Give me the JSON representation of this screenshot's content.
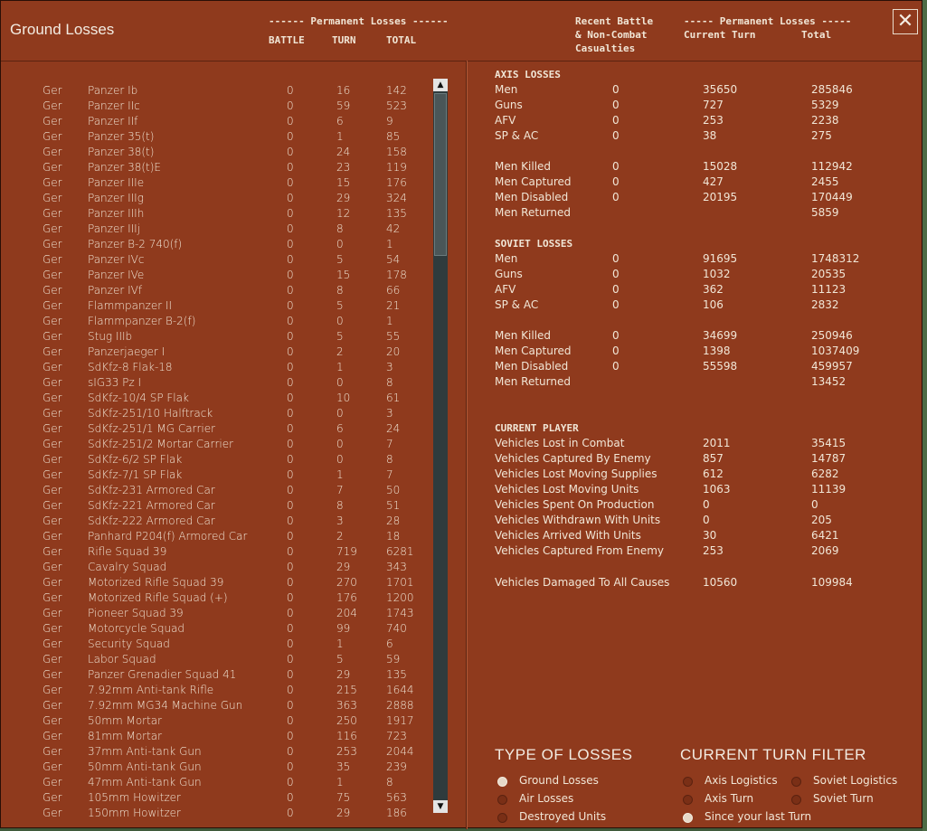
{
  "window": {
    "title": "Ground Losses",
    "close_icon": "close-icon"
  },
  "header": {
    "perm_losses_left": "------ Permanent Losses ------",
    "col_battle": "BATTLE",
    "col_turn": "TURN",
    "col_total": "TOTAL",
    "recent_battle": "Recent Battle",
    "non_combat": "& Non-Combat",
    "casualties": "Casualties",
    "perm_losses_right": "----- Permanent Losses -----",
    "col_current_turn": "Current Turn",
    "col_total_right": "Total"
  },
  "units": [
    {
      "nat": "Ger",
      "name": "Panzer Ib",
      "battle": "0",
      "turn": "16",
      "total": "142"
    },
    {
      "nat": "Ger",
      "name": "Panzer IIc",
      "battle": "0",
      "turn": "59",
      "total": "523"
    },
    {
      "nat": "Ger",
      "name": "Panzer IIf",
      "battle": "0",
      "turn": "6",
      "total": "9"
    },
    {
      "nat": "Ger",
      "name": "Panzer 35(t)",
      "battle": "0",
      "turn": "1",
      "total": "85"
    },
    {
      "nat": "Ger",
      "name": "Panzer 38(t)",
      "battle": "0",
      "turn": "24",
      "total": "158"
    },
    {
      "nat": "Ger",
      "name": "Panzer 38(t)E",
      "battle": "0",
      "turn": "23",
      "total": "119"
    },
    {
      "nat": "Ger",
      "name": "Panzer IIIe",
      "battle": "0",
      "turn": "15",
      "total": "176"
    },
    {
      "nat": "Ger",
      "name": "Panzer IIIg",
      "battle": "0",
      "turn": "29",
      "total": "324"
    },
    {
      "nat": "Ger",
      "name": "Panzer IIIh",
      "battle": "0",
      "turn": "12",
      "total": "135"
    },
    {
      "nat": "Ger",
      "name": "Panzer IIIj",
      "battle": "0",
      "turn": "8",
      "total": "42"
    },
    {
      "nat": "Ger",
      "name": "Panzer B-2 740(f)",
      "battle": "0",
      "turn": "0",
      "total": "1"
    },
    {
      "nat": "Ger",
      "name": "Panzer IVc",
      "battle": "0",
      "turn": "5",
      "total": "54"
    },
    {
      "nat": "Ger",
      "name": "Panzer IVe",
      "battle": "0",
      "turn": "15",
      "total": "178"
    },
    {
      "nat": "Ger",
      "name": "Panzer IVf",
      "battle": "0",
      "turn": "8",
      "total": "66"
    },
    {
      "nat": "Ger",
      "name": "Flammpanzer II",
      "battle": "0",
      "turn": "5",
      "total": "21"
    },
    {
      "nat": "Ger",
      "name": "Flammpanzer B-2(f)",
      "battle": "0",
      "turn": "0",
      "total": "1"
    },
    {
      "nat": "Ger",
      "name": "Stug IIIb",
      "battle": "0",
      "turn": "5",
      "total": "55"
    },
    {
      "nat": "Ger",
      "name": "Panzerjaeger I",
      "battle": "0",
      "turn": "2",
      "total": "20"
    },
    {
      "nat": "Ger",
      "name": "SdKfz-8 Flak-18",
      "battle": "0",
      "turn": "1",
      "total": "3"
    },
    {
      "nat": "Ger",
      "name": "sIG33 Pz I",
      "battle": "0",
      "turn": "0",
      "total": "8"
    },
    {
      "nat": "Ger",
      "name": "SdKfz-10/4 SP Flak",
      "battle": "0",
      "turn": "10",
      "total": "61"
    },
    {
      "nat": "Ger",
      "name": "SdKfz-251/10 Halftrack",
      "battle": "0",
      "turn": "0",
      "total": "3"
    },
    {
      "nat": "Ger",
      "name": "SdKfz-251/1 MG Carrier",
      "battle": "0",
      "turn": "6",
      "total": "24"
    },
    {
      "nat": "Ger",
      "name": "SdKfz-251/2 Mortar Carrier",
      "battle": "0",
      "turn": "0",
      "total": "7"
    },
    {
      "nat": "Ger",
      "name": "SdKfz-6/2 SP Flak",
      "battle": "0",
      "turn": "0",
      "total": "8"
    },
    {
      "nat": "Ger",
      "name": "SdKfz-7/1 SP Flak",
      "battle": "0",
      "turn": "1",
      "total": "7"
    },
    {
      "nat": "Ger",
      "name": "SdKfz-231 Armored Car",
      "battle": "0",
      "turn": "7",
      "total": "50"
    },
    {
      "nat": "Ger",
      "name": "SdKfz-221 Armored Car",
      "battle": "0",
      "turn": "8",
      "total": "51"
    },
    {
      "nat": "Ger",
      "name": "SdKfz-222 Armored Car",
      "battle": "0",
      "turn": "3",
      "total": "28"
    },
    {
      "nat": "Ger",
      "name": "Panhard P204(f) Armored Car",
      "battle": "0",
      "turn": "2",
      "total": "18"
    },
    {
      "nat": "Ger",
      "name": "Rifle Squad 39",
      "battle": "0",
      "turn": "719",
      "total": "6281"
    },
    {
      "nat": "Ger",
      "name": "Cavalry Squad",
      "battle": "0",
      "turn": "29",
      "total": "343"
    },
    {
      "nat": "Ger",
      "name": "Motorized Rifle Squad 39",
      "battle": "0",
      "turn": "270",
      "total": "1701"
    },
    {
      "nat": "Ger",
      "name": "Motorized Rifle Squad (+)",
      "battle": "0",
      "turn": "176",
      "total": "1200"
    },
    {
      "nat": "Ger",
      "name": "Pioneer Squad 39",
      "battle": "0",
      "turn": "204",
      "total": "1743"
    },
    {
      "nat": "Ger",
      "name": "Motorcycle Squad",
      "battle": "0",
      "turn": "99",
      "total": "740"
    },
    {
      "nat": "Ger",
      "name": "Security Squad",
      "battle": "0",
      "turn": "1",
      "total": "6"
    },
    {
      "nat": "Ger",
      "name": "Labor Squad",
      "battle": "0",
      "turn": "5",
      "total": "59"
    },
    {
      "nat": "Ger",
      "name": "Panzer Grenadier Squad 41",
      "battle": "0",
      "turn": "29",
      "total": "135"
    },
    {
      "nat": "Ger",
      "name": "7.92mm Anti-tank Rifle",
      "battle": "0",
      "turn": "215",
      "total": "1644"
    },
    {
      "nat": "Ger",
      "name": "7.92mm MG34 Machine Gun",
      "battle": "0",
      "turn": "363",
      "total": "2888"
    },
    {
      "nat": "Ger",
      "name": "50mm Mortar",
      "battle": "0",
      "turn": "250",
      "total": "1917"
    },
    {
      "nat": "Ger",
      "name": "81mm Mortar",
      "battle": "0",
      "turn": "116",
      "total": "723"
    },
    {
      "nat": "Ger",
      "name": "37mm Anti-tank Gun",
      "battle": "0",
      "turn": "253",
      "total": "2044"
    },
    {
      "nat": "Ger",
      "name": "50mm Anti-tank Gun",
      "battle": "0",
      "turn": "35",
      "total": "239"
    },
    {
      "nat": "Ger",
      "name": "47mm Anti-tank Gun",
      "battle": "0",
      "turn": "1",
      "total": "8"
    },
    {
      "nat": "Ger",
      "name": "105mm Howitzer",
      "battle": "0",
      "turn": "75",
      "total": "563"
    },
    {
      "nat": "Ger",
      "name": "150mm Howitzer",
      "battle": "0",
      "turn": "29",
      "total": "186"
    }
  ],
  "axis": {
    "heading": "AXIS LOSSES",
    "rows": [
      {
        "label": "Men",
        "recent": "0",
        "turn": "35650",
        "total": "285846"
      },
      {
        "label": "Guns",
        "recent": "0",
        "turn": "727",
        "total": "5329"
      },
      {
        "label": "AFV",
        "recent": "0",
        "turn": "253",
        "total": "2238"
      },
      {
        "label": "SP & AC",
        "recent": "0",
        "turn": "38",
        "total": "275"
      }
    ],
    "rows2": [
      {
        "label": "Men Killed",
        "recent": "0",
        "turn": "15028",
        "total": "112942"
      },
      {
        "label": "Men Captured",
        "recent": "0",
        "turn": "427",
        "total": "2455"
      },
      {
        "label": "Men Disabled",
        "recent": "0",
        "turn": "20195",
        "total": "170449"
      },
      {
        "label": "Men Returned",
        "recent": "",
        "turn": "",
        "total": "5859"
      }
    ]
  },
  "soviet": {
    "heading": "SOVIET LOSSES",
    "rows": [
      {
        "label": "Men",
        "recent": "0",
        "turn": "91695",
        "total": "1748312"
      },
      {
        "label": "Guns",
        "recent": "0",
        "turn": "1032",
        "total": "20535"
      },
      {
        "label": "AFV",
        "recent": "0",
        "turn": "362",
        "total": "11123"
      },
      {
        "label": "SP & AC",
        "recent": "0",
        "turn": "106",
        "total": "2832"
      }
    ],
    "rows2": [
      {
        "label": "Men Killed",
        "recent": "0",
        "turn": "34699",
        "total": "250946"
      },
      {
        "label": "Men Captured",
        "recent": "0",
        "turn": "1398",
        "total": "1037409"
      },
      {
        "label": "Men Disabled",
        "recent": "0",
        "turn": "55598",
        "total": "459957"
      },
      {
        "label": "Men Returned",
        "recent": "",
        "turn": "",
        "total": "13452"
      }
    ]
  },
  "player": {
    "heading": "CURRENT PLAYER",
    "rows": [
      {
        "label": "Vehicles Lost in Combat",
        "turn": "2011",
        "total": "35415"
      },
      {
        "label": "Vehicles Captured By Enemy",
        "turn": "857",
        "total": "14787"
      },
      {
        "label": "Vehicles Lost Moving Supplies",
        "turn": "612",
        "total": "6282"
      },
      {
        "label": "Vehicles Lost Moving Units",
        "turn": "1063",
        "total": "11139"
      },
      {
        "label": "Vehicles Spent On Production",
        "turn": "0",
        "total": "0"
      },
      {
        "label": "Vehicles Withdrawn With Units",
        "turn": "0",
        "total": "205"
      },
      {
        "label": "Vehicles Arrived With Units",
        "turn": "30",
        "total": "6421"
      },
      {
        "label": "Vehicles Captured From Enemy",
        "turn": "253",
        "total": "2069"
      }
    ],
    "damaged": {
      "label": "Vehicles Damaged To All Causes",
      "turn": "10560",
      "total": "109984"
    }
  },
  "type_of_losses": {
    "heading": "TYPE OF LOSSES",
    "options": [
      {
        "label": "Ground Losses",
        "selected": true
      },
      {
        "label": "Air Losses",
        "selected": false
      },
      {
        "label": "Destroyed Units",
        "selected": false
      }
    ]
  },
  "turn_filter": {
    "heading": "CURRENT TURN FILTER",
    "options": [
      {
        "label": "Axis Logistics",
        "selected": false
      },
      {
        "label": "Soviet Logistics",
        "selected": false
      },
      {
        "label": "Axis Turn",
        "selected": false
      },
      {
        "label": "Soviet Turn",
        "selected": false
      },
      {
        "label": "Since your last Turn",
        "selected": true
      }
    ]
  },
  "colors": {
    "panel": "#8f3a1d",
    "text": "#f1e6d6",
    "scroll_track": "#2f3b3d"
  }
}
